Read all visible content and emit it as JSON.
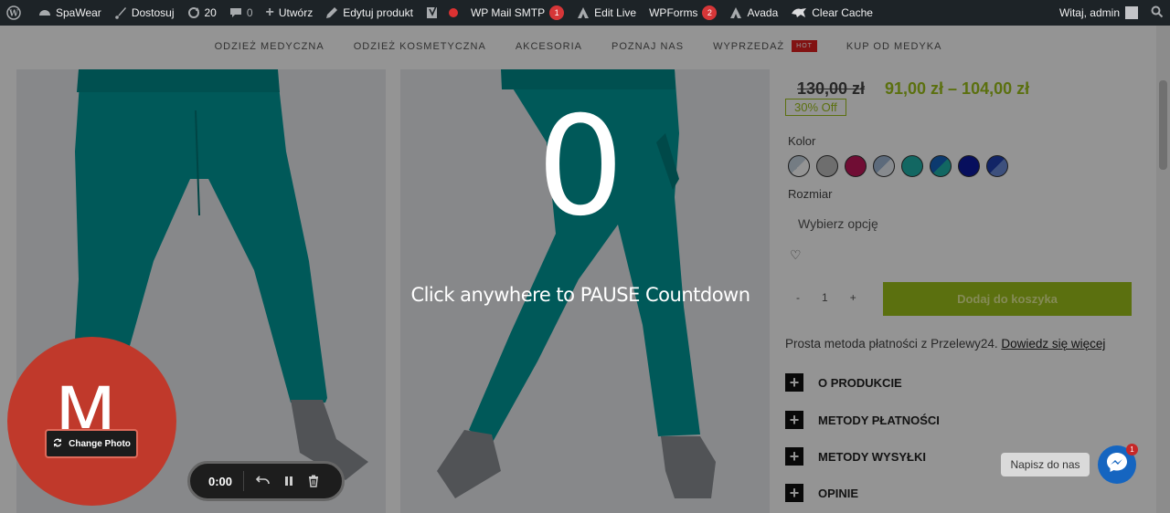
{
  "admin_bar": {
    "wp_logo": "wordpress-icon",
    "site_name": "SpaWear",
    "customize": "Dostosuj",
    "updates_count": "20",
    "comments_count": "0",
    "new_label": "Utwórz",
    "edit_product": "Edytuj produkt",
    "wp_mail_smtp": "WP Mail SMTP",
    "wp_mail_smtp_badge": "1",
    "edit_live": "Edit Live",
    "wpforms": "WPForms",
    "wpforms_badge": "2",
    "avada": "Avada",
    "clear_cache": "Clear Cache",
    "greeting": "Witaj, admin"
  },
  "nav": {
    "items": [
      "ODZIEŻ MEDYCZNA",
      "ODZIEŻ KOSMETYCZNA",
      "AKCESORIA",
      "POZNAJ NAS",
      "WYPRZEDAŻ",
      "KUP OD MEDYKA"
    ],
    "hot_badge": "HOT"
  },
  "product": {
    "price_old": "130,00 zł",
    "price_new": "91,00 zł – 104,00 zł",
    "discount": "30% Off",
    "color_label": "Kolor",
    "swatches": [
      "#dde5ee",
      "#bdbdbd",
      "#c2185b",
      "#9fb7d4",
      "#20b2aa",
      "#1565c0",
      "#0d1aa0",
      "#1e3fb0"
    ],
    "size_label": "Rozmiar",
    "size_select": "Wybierz opcję",
    "qty_minus": "-",
    "qty_value": "1",
    "qty_plus": "+",
    "add_to_cart": "Dodaj do koszyka",
    "payment_text": "Prosta metoda płatności z Przelewy24.",
    "payment_link": "Dowiedz się więcej",
    "accordion": [
      "O PRODUKCIE",
      "METODY PŁATNOŚCI",
      "METODY WYSYŁKI",
      "OPINIE"
    ]
  },
  "overlay": {
    "countdown": "0",
    "message": "Click anywhere to PAUSE Countdown"
  },
  "recorder": {
    "avatar_letter": "M",
    "change_photo": "Change Photo",
    "time": "0:00"
  },
  "chat": {
    "label": "Napisz do nas",
    "badge": "1"
  },
  "colors": {
    "admin_bar_bg": "#1d2327",
    "accent_green": "#9ec21a",
    "recorder_avatar": "#c0392b",
    "messenger_blue": "#1565c0"
  }
}
